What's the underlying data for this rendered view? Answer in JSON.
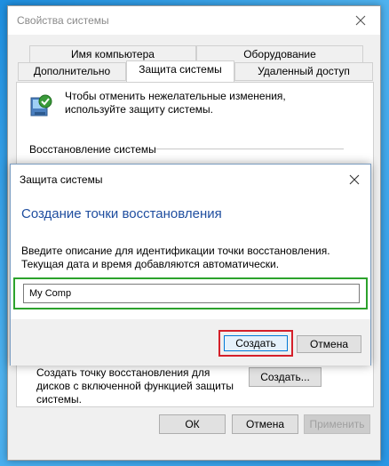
{
  "window": {
    "title": "Свойства системы",
    "tabs_row1": [
      "Имя компьютера",
      "Оборудование"
    ],
    "tabs_row2": [
      "Дополнительно",
      "Защита системы",
      "Удаленный доступ"
    ],
    "info_text": "Чтобы отменить нежелательные изменения, используйте защиту системы.",
    "section_restore": "Восстановление системы",
    "create_desc": "Создать точку восстановления для дисков с включенной функцией защиты системы.",
    "create_button": "Создать...",
    "ok_button": "ОК",
    "cancel_button": "Отмена",
    "apply_button": "Применить"
  },
  "modal": {
    "title": "Защита системы",
    "heading": "Создание точки восстановления",
    "description": "Введите описание для идентификации точки восстановления. Текущая дата и время добавляются автоматически.",
    "input_value": "My Comp",
    "create_button": "Создать",
    "cancel_button": "Отмена"
  },
  "colors": {
    "heading": "#1e4d9f",
    "highlight_input": "#2ca22c",
    "highlight_button": "#d4202a",
    "desktop": "#2a97e6"
  }
}
